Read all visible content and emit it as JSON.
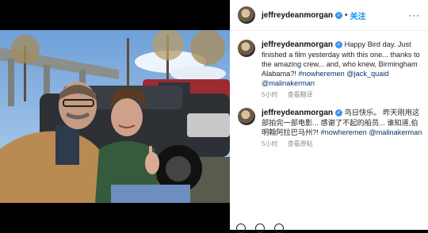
{
  "post": {
    "username": "jeffreydeanmorgan",
    "follow_label": "关注",
    "more_icon": "more-horizontal-icon"
  },
  "caption": {
    "username": "jeffreydeanmorgan",
    "text": "Happy Bird day. Just finished a film yesterday with this one... thanks to the amazing crew... and, who knew, Birmingham Alabama?! ",
    "hashtag": "#nowheremen",
    "mention1": "@jack_quaid",
    "mention2": "@malinakerman",
    "time": "5小时",
    "translate_label": "查看翻译"
  },
  "translation": {
    "username": "jeffreydeanmorgan",
    "text": "鸟日快乐。 昨天刚用这部拍完一部电影... 感谢了不起的船员... 谁知道,伯明翰阿拉巴马州?! ",
    "hashtag": "#nowheremen",
    "mention": "@malinakerman",
    "time": "5小时",
    "original_label": "查看原帖"
  }
}
